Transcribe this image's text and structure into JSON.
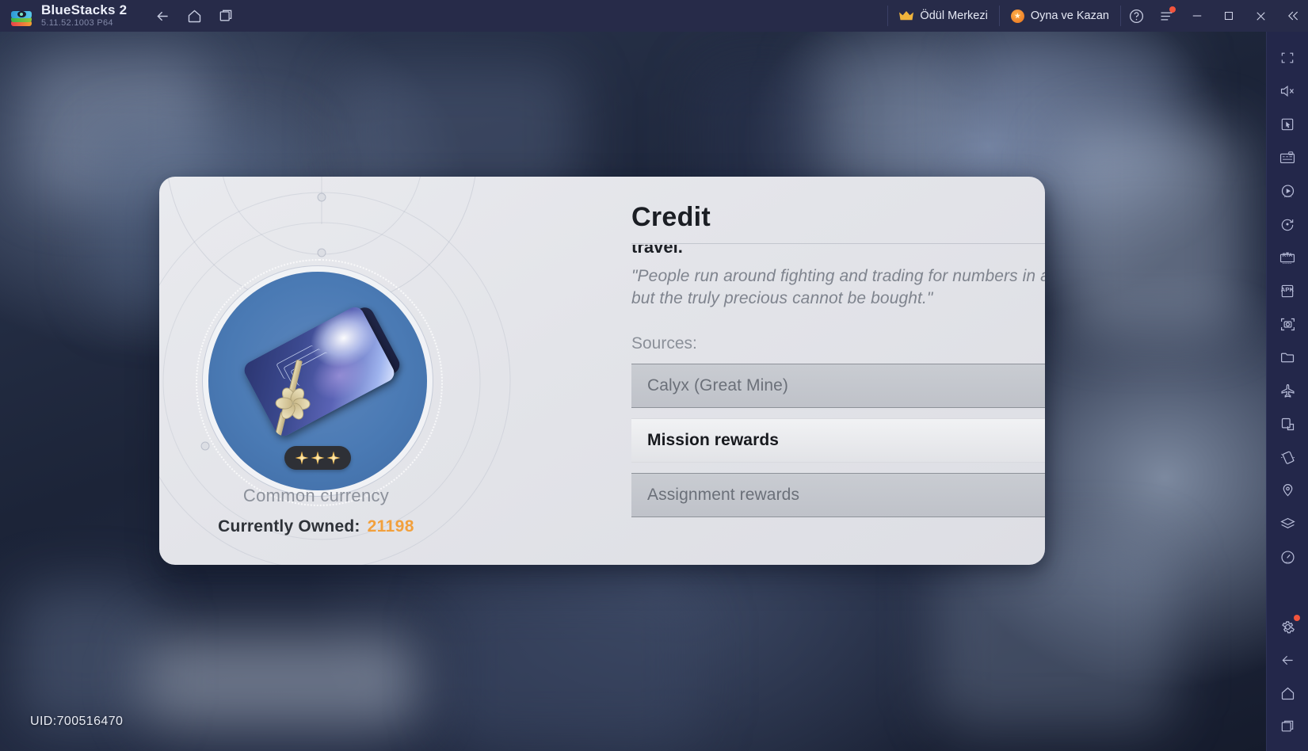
{
  "titlebar": {
    "app_name": "BlueStacks 2",
    "version": "5.11.52.1003  P64",
    "nav": [
      {
        "name": "back",
        "icon": "arrow-left-icon"
      },
      {
        "name": "home",
        "icon": "home-icon"
      },
      {
        "name": "multi-instance",
        "icon": "windows-icon"
      }
    ],
    "reward_center_label": "Ödül Merkezi",
    "play_and_earn_label": "Oyna ve Kazan",
    "help_icon": "question-circle-icon",
    "menu_icon": "hamburger-menu-icon",
    "minimize_icon": "minimize-icon",
    "maximize_icon": "maximize-icon",
    "close_icon": "close-icon",
    "collapse_icon": "chevrons-left-icon"
  },
  "sidebar": {
    "items": [
      {
        "name": "fullscreen",
        "icon": "fullscreen-icon"
      },
      {
        "name": "mute",
        "icon": "speaker-mute-icon"
      },
      {
        "name": "game-controls",
        "icon": "cursor-box-icon"
      },
      {
        "name": "keyboard-controls",
        "icon": "keymapping-icon"
      },
      {
        "name": "macro-recorder",
        "icon": "play-record-icon"
      },
      {
        "name": "rotate",
        "icon": "rotate-icon"
      },
      {
        "name": "rta",
        "icon": "rta-icon"
      },
      {
        "name": "install-apk",
        "icon": "apk-icon"
      },
      {
        "name": "screenshot",
        "icon": "camera-icon"
      },
      {
        "name": "media-manager",
        "icon": "folder-icon"
      },
      {
        "name": "eco-mode",
        "icon": "airplane-icon"
      },
      {
        "name": "multi-window",
        "icon": "pip-icon"
      },
      {
        "name": "shake",
        "icon": "shake-icon"
      },
      {
        "name": "location",
        "icon": "location-pin-icon"
      },
      {
        "name": "instance-manager",
        "icon": "layers-icon"
      },
      {
        "name": "performance",
        "icon": "gauge-icon"
      }
    ],
    "bottom_items": [
      {
        "name": "settings",
        "icon": "gear-icon",
        "badge": true
      },
      {
        "name": "back",
        "icon": "arrow-left-icon"
      },
      {
        "name": "home",
        "icon": "home-icon"
      },
      {
        "name": "recents",
        "icon": "recents-icon"
      }
    ]
  },
  "game": {
    "uid": "UID:700516470"
  },
  "modal": {
    "title": "Credit",
    "close_icon": "close-icon",
    "item": {
      "icon_name": "credit-card-item-icon",
      "rarity_stars": 3,
      "rarity_star_icon": "four-point-star-icon",
      "subtitle": "Common currency",
      "owned_label": "Currently Owned:",
      "owned_value": "21198"
    },
    "description": {
      "clipped_line": "travel.",
      "quote": "\"People run around fighting and trading for numbers in a terminal, but the truly precious cannot be bought.\""
    },
    "sources_label": "Sources:",
    "sources": [
      {
        "label": "Calyx (Great Mine)",
        "locked": true,
        "lock_icon": "lock-icon"
      },
      {
        "label": "Mission rewards",
        "locked": false,
        "lock_icon": ""
      },
      {
        "label": "Assignment rewards",
        "locked": true,
        "lock_icon": "lock-icon"
      }
    ],
    "colors": {
      "accent_orange": "#f2a03c",
      "panel_bg": "#e6e7eb",
      "locked_row": "#c5c8ce",
      "item_circle": "#4a7ab4"
    }
  }
}
